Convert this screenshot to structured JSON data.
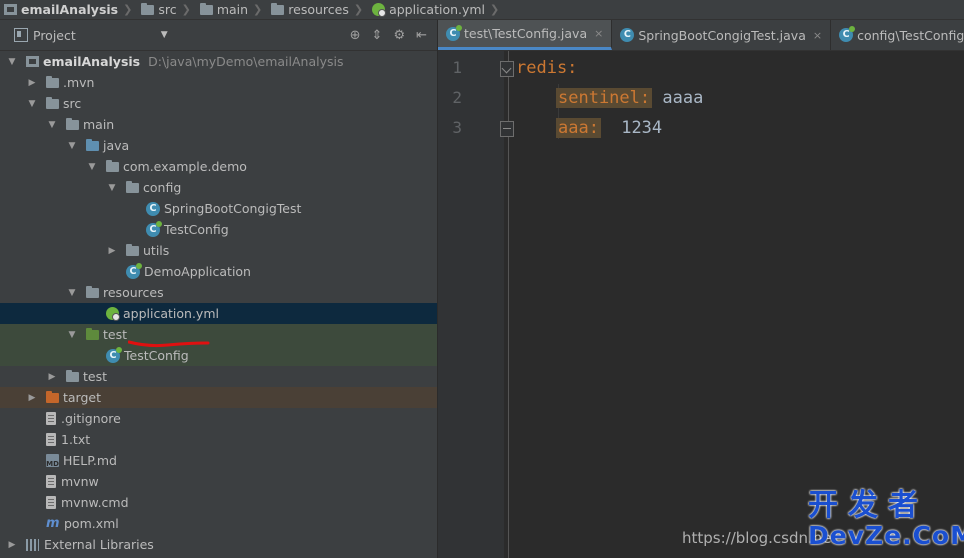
{
  "breadcrumb": {
    "items": [
      "emailAnalysis",
      "src",
      "main",
      "resources",
      "application.yml"
    ]
  },
  "project_panel": {
    "title": "Project",
    "tree": [
      {
        "label": "emailAnalysis",
        "path": "D:\\java\\myDemo\\emailAnalysis"
      },
      {
        "label": ".mvn"
      },
      {
        "label": "src"
      },
      {
        "label": "main"
      },
      {
        "label": "java"
      },
      {
        "label": "com.example.demo"
      },
      {
        "label": "config"
      },
      {
        "label": "SpringBootCongigTest"
      },
      {
        "label": "TestConfig"
      },
      {
        "label": "utils"
      },
      {
        "label": "DemoApplication"
      },
      {
        "label": "resources"
      },
      {
        "label": "application.yml"
      },
      {
        "label": "test"
      },
      {
        "label": "TestConfig"
      },
      {
        "label": "test"
      },
      {
        "label": "target"
      },
      {
        "label": ".gitignore"
      },
      {
        "label": "1.txt"
      },
      {
        "label": "HELP.md"
      },
      {
        "label": "mvnw"
      },
      {
        "label": "mvnw.cmd"
      },
      {
        "label": "pom.xml"
      },
      {
        "label": "External Libraries"
      }
    ]
  },
  "editor": {
    "tabs": [
      {
        "label": "test\\TestConfig.java",
        "close": "×"
      },
      {
        "label": "SpringBootCongigTest.java",
        "close": "×"
      },
      {
        "label": "config\\TestConfig.java"
      }
    ],
    "lines": [
      {
        "num": "1",
        "key": "redis:",
        "value": ""
      },
      {
        "num": "2",
        "key": "sentinel:",
        "value": "aaaa"
      },
      {
        "num": "3",
        "key": "aaa:",
        "value": "1234"
      }
    ]
  },
  "watermark": {
    "url_text": "https://blog.csdn.ne",
    "brand_cn": "开发者",
    "brand_en": "DevZe.CoM"
  },
  "colors": {
    "key": "#cc7832",
    "selection": "#0d293e",
    "brand": "#1a4fd0"
  }
}
